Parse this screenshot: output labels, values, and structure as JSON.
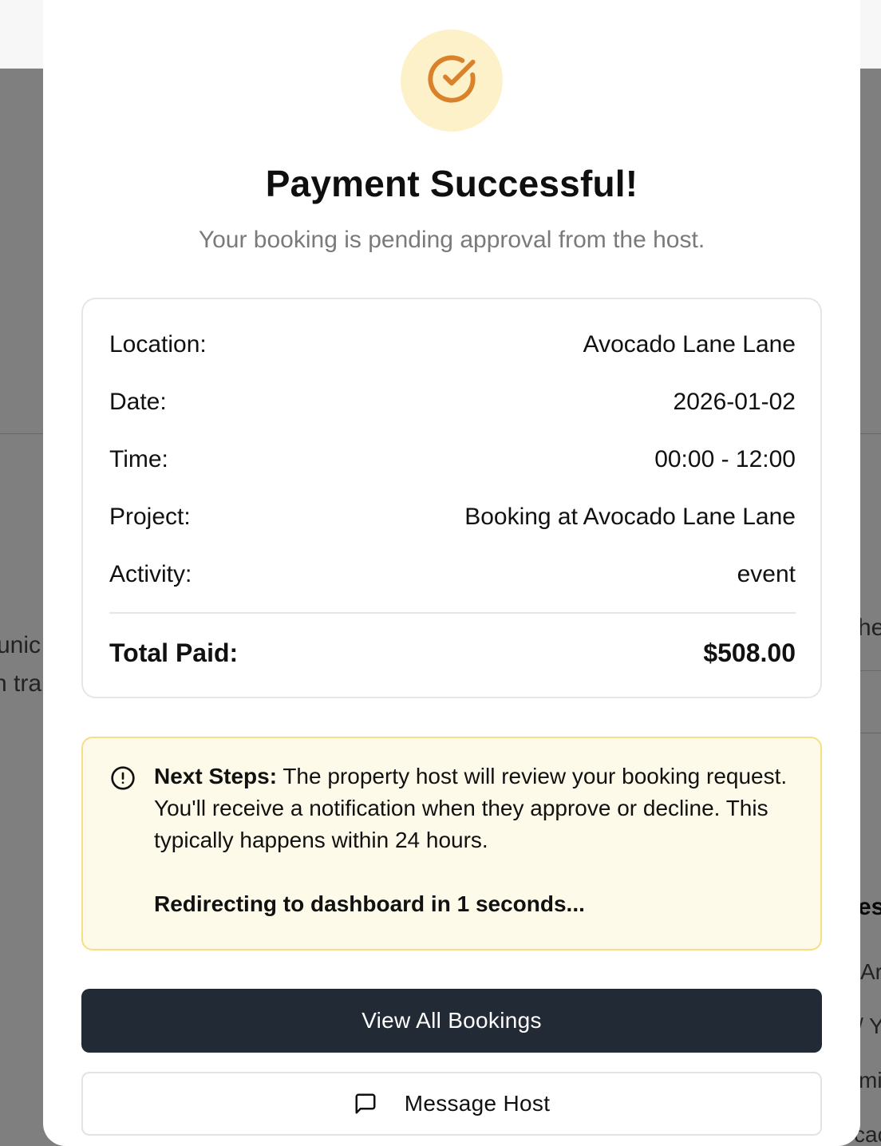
{
  "background": {
    "left_fragments": [
      "unic",
      "n tra"
    ],
    "right_fragments": [
      "he",
      "es",
      "Ar",
      "/ Y",
      "mi",
      "cac"
    ]
  },
  "modal": {
    "icon": "check-circle-icon",
    "title": "Payment Successful!",
    "subtitle": "Your booking is pending approval from the host.",
    "details": {
      "location": {
        "label": "Location:",
        "value": "Avocado Lane Lane"
      },
      "date": {
        "label": "Date:",
        "value": "2026-01-02"
      },
      "time": {
        "label": "Time:",
        "value": "00:00 - 12:00"
      },
      "project": {
        "label": "Project:",
        "value": "Booking at Avocado Lane Lane"
      },
      "activity": {
        "label": "Activity:",
        "value": "event"
      },
      "total": {
        "label": "Total Paid:",
        "value": "$508.00"
      }
    },
    "notice": {
      "icon": "alert-circle-icon",
      "heading": "Next Steps:",
      "body": " The property host will review your booking request. You'll receive a notification when they approve or decline. This typically happens within 24 hours.",
      "redirect": "Redirecting to dashboard in 1 seconds..."
    },
    "buttons": {
      "view_all": "View All Bookings",
      "message_host": "Message Host",
      "message_icon": "message-square-icon"
    }
  },
  "colors": {
    "accent": "#d9822b",
    "success_bg": "#fdf1c9",
    "notice_bg": "#fefae9",
    "notice_border": "#f6de82",
    "primary_button": "#222a36"
  }
}
